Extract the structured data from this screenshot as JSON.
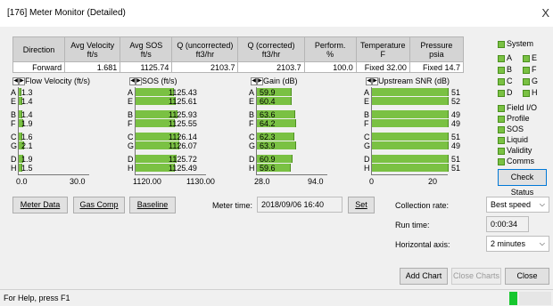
{
  "window": {
    "title": "[176] Meter Monitor (Detailed)",
    "close": "X"
  },
  "table": {
    "headers": [
      [
        "Direction",
        ""
      ],
      [
        "Avg Velocity",
        "ft/s"
      ],
      [
        "Avg SOS",
        "ft/s"
      ],
      [
        "Q (uncorrected)",
        "ft3/hr"
      ],
      [
        "Q (corrected)",
        "ft3/hr"
      ],
      [
        "Perform.",
        "%"
      ],
      [
        "Temperature",
        "F"
      ],
      [
        "Pressure",
        "psia"
      ]
    ],
    "row": [
      "Forward",
      "1.681",
      "1125.74",
      "2103.7",
      "2103.7",
      "100.0",
      "Fixed 32.00",
      "Fixed 14.7"
    ]
  },
  "charts": {
    "velocity": {
      "title": "Flow Velocity (ft/s)",
      "rows": [
        {
          "letter": "A",
          "value": "1.3",
          "num": 1.3
        },
        {
          "letter": "E",
          "value": "1.4",
          "num": 1.4
        },
        {
          "letter": "B",
          "value": "1.4",
          "num": 1.4
        },
        {
          "letter": "F",
          "value": "1.9",
          "num": 1.9
        },
        {
          "letter": "C",
          "value": "1.6",
          "num": 1.6
        },
        {
          "letter": "G",
          "value": "2.1",
          "num": 2.1
        },
        {
          "letter": "D",
          "value": "1.9",
          "num": 1.9
        },
        {
          "letter": "H",
          "value": "1.5",
          "num": 1.5
        }
      ],
      "min": 0.0,
      "max": 30.0,
      "tick_min": "0.0",
      "tick_max": "30.0"
    },
    "sos": {
      "title": "SOS (ft/s)",
      "rows": [
        {
          "letter": "A",
          "value": "1125.43",
          "num": 1125.43
        },
        {
          "letter": "E",
          "value": "1125.61",
          "num": 1125.61
        },
        {
          "letter": "B",
          "value": "1125.93",
          "num": 1125.93
        },
        {
          "letter": "F",
          "value": "1125.55",
          "num": 1125.55
        },
        {
          "letter": "C",
          "value": "1126.14",
          "num": 1126.14
        },
        {
          "letter": "G",
          "value": "1126.07",
          "num": 1126.07
        },
        {
          "letter": "D",
          "value": "1125.72",
          "num": 1125.72
        },
        {
          "letter": "H",
          "value": "1125.49",
          "num": 1125.49
        }
      ],
      "min": 1120.0,
      "max": 1130.0,
      "tick_min": "1120.00",
      "tick_max": "1130.00"
    },
    "gain": {
      "title": "Gain (dB)",
      "rows": [
        {
          "letter": "A",
          "value": "59.9",
          "num": 59.9
        },
        {
          "letter": "E",
          "value": "60.4",
          "num": 60.4
        },
        {
          "letter": "B",
          "value": "63.6",
          "num": 63.6
        },
        {
          "letter": "F",
          "value": "64.2",
          "num": 64.2
        },
        {
          "letter": "C",
          "value": "62.3",
          "num": 62.3
        },
        {
          "letter": "G",
          "value": "63.9",
          "num": 63.9
        },
        {
          "letter": "D",
          "value": "60.9",
          "num": 60.9
        },
        {
          "letter": "H",
          "value": "59.6",
          "num": 59.6
        }
      ],
      "min": 28.0,
      "max": 94.0,
      "tick_min": "28.0",
      "tick_max": "94.0"
    },
    "snr": {
      "title": "Upstream SNR (dB)",
      "rows": [
        {
          "letter": "A",
          "value": "51",
          "num": 51
        },
        {
          "letter": "E",
          "value": "52",
          "num": 52
        },
        {
          "letter": "B",
          "value": "49",
          "num": 49
        },
        {
          "letter": "F",
          "value": "49",
          "num": 49
        },
        {
          "letter": "C",
          "value": "51",
          "num": 51
        },
        {
          "letter": "G",
          "value": "49",
          "num": 49
        },
        {
          "letter": "D",
          "value": "51",
          "num": 51
        },
        {
          "letter": "H",
          "value": "51",
          "num": 51
        }
      ],
      "min": 0,
      "max": 20,
      "tick_min": "0",
      "tick_max": "20"
    }
  },
  "right_panel": {
    "system": "System",
    "chords": [
      "A",
      "E",
      "B",
      "F",
      "C",
      "G",
      "D",
      "H"
    ],
    "items": [
      "Field I/O",
      "Profile",
      "SOS",
      "Liquid",
      "Validity",
      "Comms"
    ],
    "check_status": "Check Status"
  },
  "bottom": {
    "meter_data": "Meter Data",
    "gas_comp": "Gas Comp",
    "baseline": "Baseline",
    "meter_time_label": "Meter time:",
    "meter_time_value": "2018/09/06 16:40",
    "set": "Set",
    "collection_rate_label": "Collection rate:",
    "collection_rate_value": "Best speed",
    "run_time_label": "Run time:",
    "run_time_value": "0:00:34",
    "horizontal_axis_label": "Horizontal axis:",
    "horizontal_axis_value": "2 minutes",
    "add_chart": "Add Chart",
    "close_charts": "Close Charts",
    "close": "Close"
  },
  "status": {
    "message": "For Help, press F1"
  },
  "colors": {
    "bar": "#7ac143",
    "indicator": "#16c72e"
  }
}
